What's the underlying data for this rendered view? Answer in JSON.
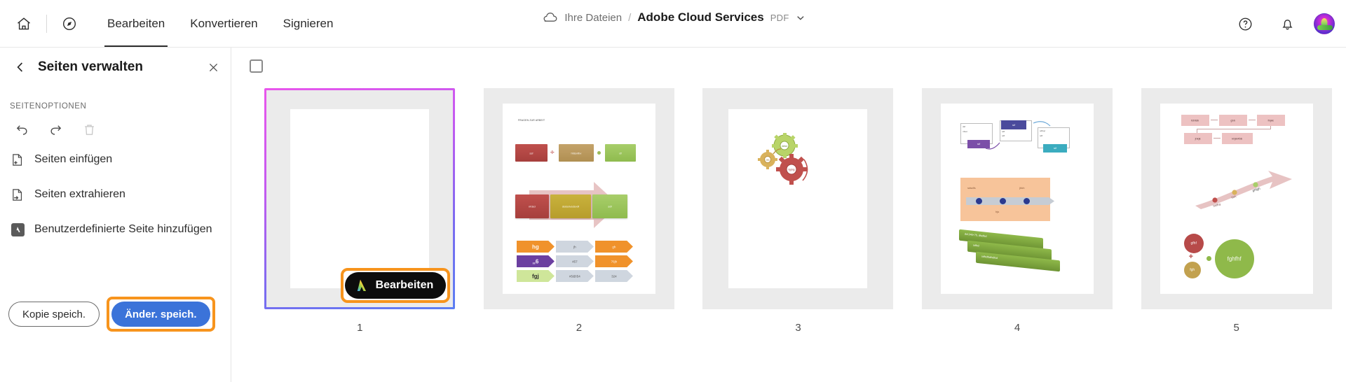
{
  "topbar": {
    "home_icon": "home-icon",
    "compass_icon": "compass-icon",
    "tabs": [
      {
        "label": "Bearbeiten",
        "active": true
      },
      {
        "label": "Konvertieren",
        "active": false
      },
      {
        "label": "Signieren",
        "active": false
      }
    ],
    "breadcrumb": {
      "cloud_icon": "cloud-icon",
      "root": "Ihre Dateien",
      "separator": "/",
      "file": "Adobe Cloud Services",
      "filetype": "PDF",
      "chevron_icon": "chevron-down-icon"
    },
    "help_icon": "help-circle-icon",
    "bell_icon": "bell-icon",
    "avatar": "user-avatar"
  },
  "sidebar": {
    "back_icon": "chevron-left-icon",
    "title": "Seiten verwalten",
    "close_icon": "close-icon",
    "section_label": "SEITENOPTIONEN",
    "tools": [
      {
        "name": "undo-icon",
        "label": "Rückgängig",
        "disabled": false
      },
      {
        "name": "redo-icon",
        "label": "Wiederholen",
        "disabled": false
      },
      {
        "name": "trash-icon",
        "label": "Löschen",
        "disabled": true
      }
    ],
    "items": [
      {
        "icon": "insert-pages-icon",
        "label": "Seiten einfügen"
      },
      {
        "icon": "extract-pages-icon",
        "label": "Seiten extrahieren"
      },
      {
        "icon": "adobe-logo-icon",
        "label": "Benutzerdefinierte Seite hinzufügen"
      }
    ],
    "save_copy_label": "Kopie speich.",
    "save_changes_label": "Änder. speich.",
    "focus_color": "#f7941d",
    "primary_color": "#3b73d9"
  },
  "main": {
    "select_all_checkbox": "select-all-pages",
    "selected_page": 1,
    "edit_chip": {
      "label": "Bearbeiten",
      "icon": "adobe-acrobat-ai-icon"
    },
    "pages": [
      {
        "number": "1",
        "selected": true,
        "content": "blank"
      },
      {
        "number": "2",
        "selected": false,
        "content": "diagram-boxes-arrows"
      },
      {
        "number": "3",
        "selected": false,
        "content": "gears-graphic"
      },
      {
        "number": "4",
        "selected": false,
        "content": "cards-timeline-bars"
      },
      {
        "number": "5",
        "selected": false,
        "content": "flowchart-arrow-circles"
      }
    ],
    "page2_text": {
      "heading": "FRAGEN ZUR ARBEIT",
      "row1": [
        "ssf",
        "hfdsvfbv",
        "df"
      ],
      "row2": [
        "nfdsd",
        "dsdsdvsdsvdf",
        "sdf"
      ],
      "bars": [
        [
          "hg",
          "jh",
          "gh"
        ],
        [
          ",,6",
          "457",
          "76jh"
        ],
        [
          "fgj",
          "#5@!54",
          "324"
        ]
      ]
    },
    "page4_text": {
      "cards": [
        "dsf",
        "nfuet",
        "sdf",
        "sdf",
        "sdf",
        "sdf",
        "sdfuyt",
        "sdf",
        "sdf"
      ],
      "timeline": [
        "sdsdfs",
        "jhkh",
        "hjs"
      ],
      "bars": [
        "dsf,345+75, dfsdfsd",
        "sdfsd",
        "sdfsdfsdfsdfsd"
      ]
    },
    "page5_text": {
      "flow_top": [
        "fdhfdh",
        "ghh",
        "fhjkk"
      ],
      "flow_bottom": [
        "jhkjk",
        "khjkl456"
      ],
      "arrow_labels": [
        "hfdfrg",
        "hhh",
        "ghfgh"
      ],
      "circles": [
        "gfhf",
        "fgh",
        "fghfhf"
      ]
    }
  }
}
